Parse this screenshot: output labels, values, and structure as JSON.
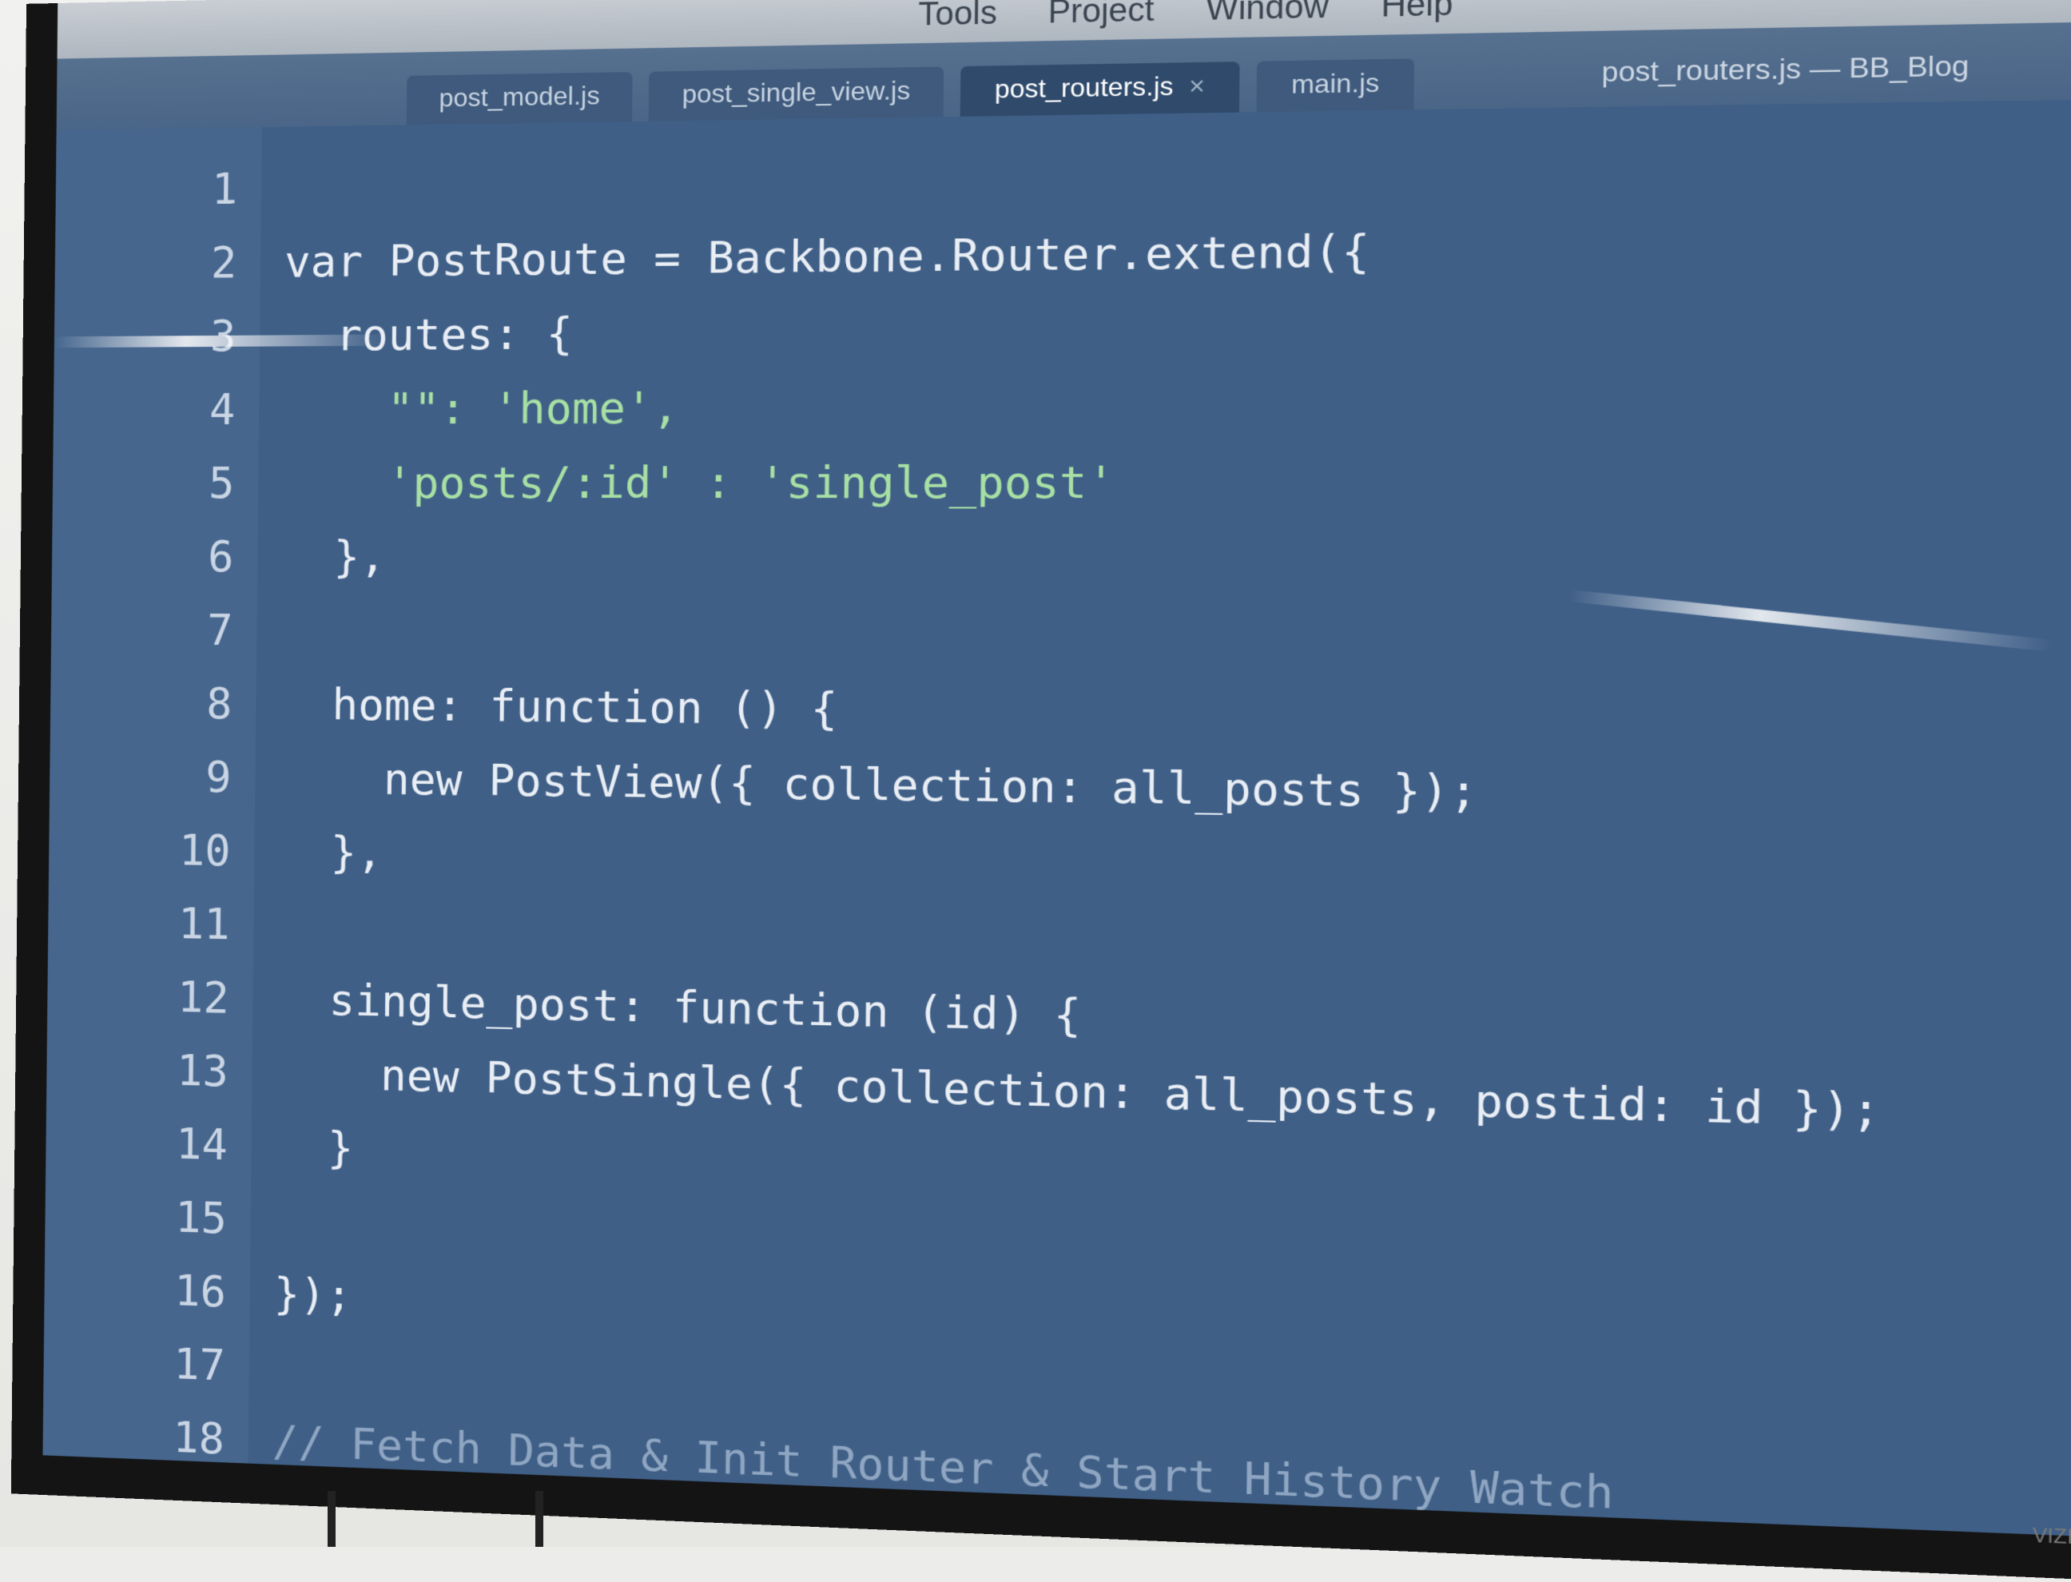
{
  "menubar": {
    "items": [
      "Tools",
      "Project",
      "Window",
      "Help"
    ]
  },
  "tabs": [
    {
      "label": "post_model.js",
      "active": false
    },
    {
      "label": "post_single_view.js",
      "active": false
    },
    {
      "label": "post_routers.js",
      "active": true
    },
    {
      "label": "main.js",
      "active": false
    }
  ],
  "window_title": "post_routers.js — BB_Blog",
  "editor": {
    "lines": [
      {
        "n": "1",
        "t": ""
      },
      {
        "n": "2",
        "t": "var PostRoute = Backbone.Router.extend({"
      },
      {
        "n": "3",
        "t": "  routes: {"
      },
      {
        "n": "4",
        "t": "    \"\": 'home',"
      },
      {
        "n": "5",
        "t": "    'posts/:id' : 'single_post'"
      },
      {
        "n": "6",
        "t": "  },"
      },
      {
        "n": "7",
        "t": ""
      },
      {
        "n": "8",
        "t": "  home: function () {"
      },
      {
        "n": "9",
        "t": "    new PostView({ collection: all_posts });"
      },
      {
        "n": "10",
        "t": "  },"
      },
      {
        "n": "11",
        "t": ""
      },
      {
        "n": "12",
        "t": "  single_post: function (id) {"
      },
      {
        "n": "13",
        "t": "    new PostSingle({ collection: all_posts, postid: id });"
      },
      {
        "n": "14",
        "t": "  }"
      },
      {
        "n": "15",
        "t": ""
      },
      {
        "n": "16",
        "t": "});"
      },
      {
        "n": "17",
        "t": ""
      },
      {
        "n": "18",
        "t": "// Fetch Data & Init Router & Start History Watch"
      }
    ]
  },
  "colors": {
    "editor_bg": "#3f5f87",
    "string": "#a8e0a4",
    "comment": "#8fa6c2"
  }
}
